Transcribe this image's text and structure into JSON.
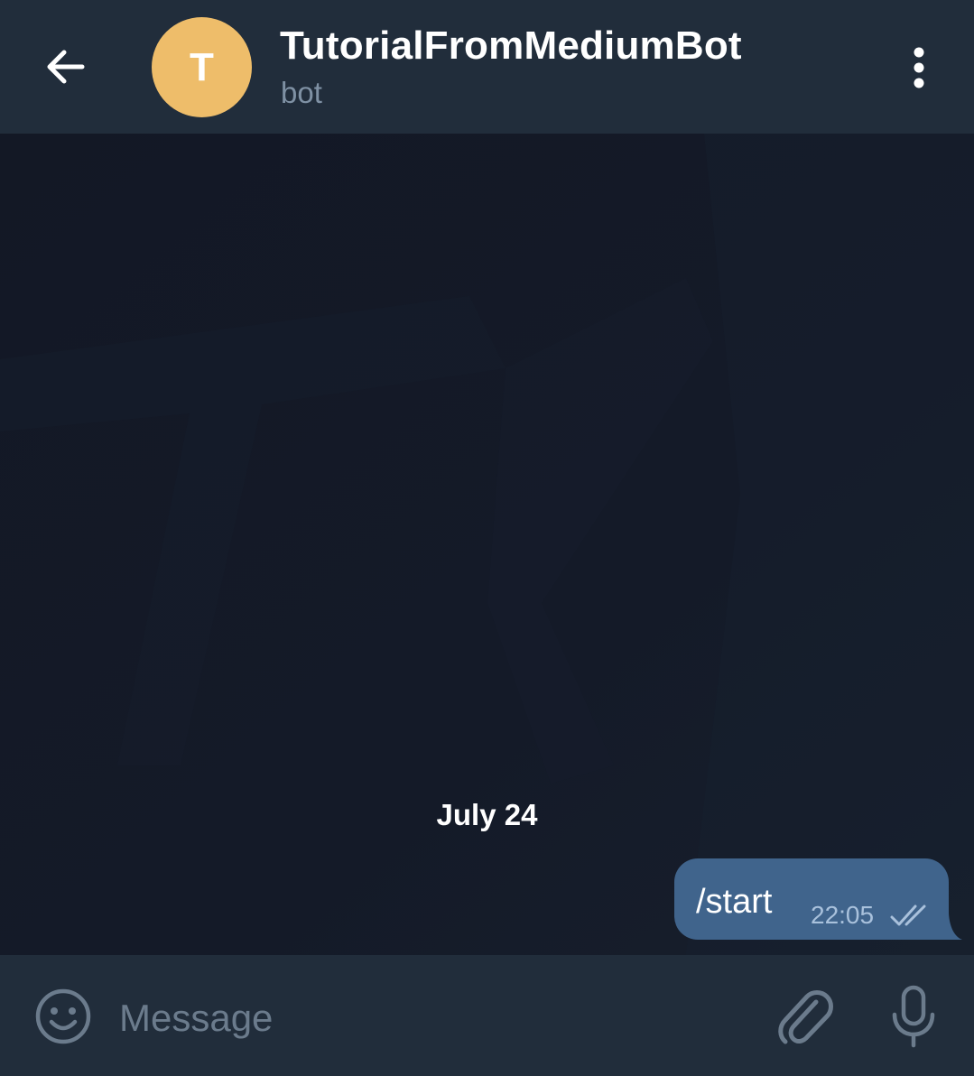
{
  "header": {
    "title": "TutorialFromMediumBot",
    "subtitle": "bot",
    "avatar_initial": "T",
    "back_icon": "arrow-left-icon",
    "menu_icon": "more-vertical-icon"
  },
  "chat": {
    "date_separator": "July 24",
    "messages": [
      {
        "direction": "outgoing",
        "text": "/start",
        "time": "22:05",
        "status": "read"
      }
    ]
  },
  "input": {
    "placeholder": "Message",
    "value": "",
    "emoji_icon": "smile-icon",
    "attach_icon": "paperclip-icon",
    "mic_icon": "microphone-icon"
  },
  "colors": {
    "header_bg": "#212d3b",
    "chat_bg": "#141a27",
    "avatar_bg": "#eebd6a",
    "bubble_bg": "#40648c",
    "subtitle": "#7f91a4",
    "icon": "#6b7b8c"
  }
}
